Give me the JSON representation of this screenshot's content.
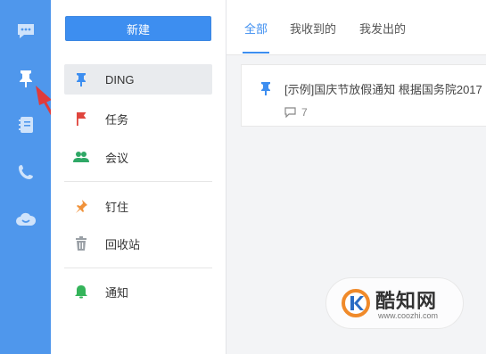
{
  "rail": {
    "items": [
      {
        "name": "chat",
        "icon": "chat-bubble-icon"
      },
      {
        "name": "ding",
        "icon": "pin-icon"
      },
      {
        "name": "notebook",
        "icon": "notebook-icon"
      },
      {
        "name": "phone",
        "icon": "phone-icon"
      },
      {
        "name": "cloud",
        "icon": "cloud-icon"
      }
    ],
    "color": "#4f97ec"
  },
  "menu": {
    "new_button": "新建",
    "items": [
      {
        "label": "DING",
        "icon": "pin-icon",
        "icon_color": "#3d8ef0",
        "active": true
      },
      {
        "label": "任务",
        "icon": "flag-icon",
        "icon_color": "#e0453d"
      },
      {
        "label": "会议",
        "icon": "people-icon",
        "icon_color": "#2fa866"
      },
      {
        "label": "钉住",
        "icon": "pushpin-icon",
        "icon_color": "#f0923a"
      },
      {
        "label": "回收站",
        "icon": "trash-icon",
        "icon_color": "#9aa0a6"
      },
      {
        "label": "通知",
        "icon": "bell-icon",
        "icon_color": "#34b45a"
      }
    ]
  },
  "tabs": [
    {
      "label": "全部",
      "active": true
    },
    {
      "label": "我收到的"
    },
    {
      "label": "我发出的"
    }
  ],
  "card": {
    "title": "[示例]国庆节放假通知 根据国务院2017",
    "comment_count": "7"
  },
  "watermark": {
    "name": "酷知网",
    "url": "www.coozhi.com"
  },
  "colors": {
    "accent": "#3d8ef0",
    "annotation_arrow": "#e03b3b"
  }
}
